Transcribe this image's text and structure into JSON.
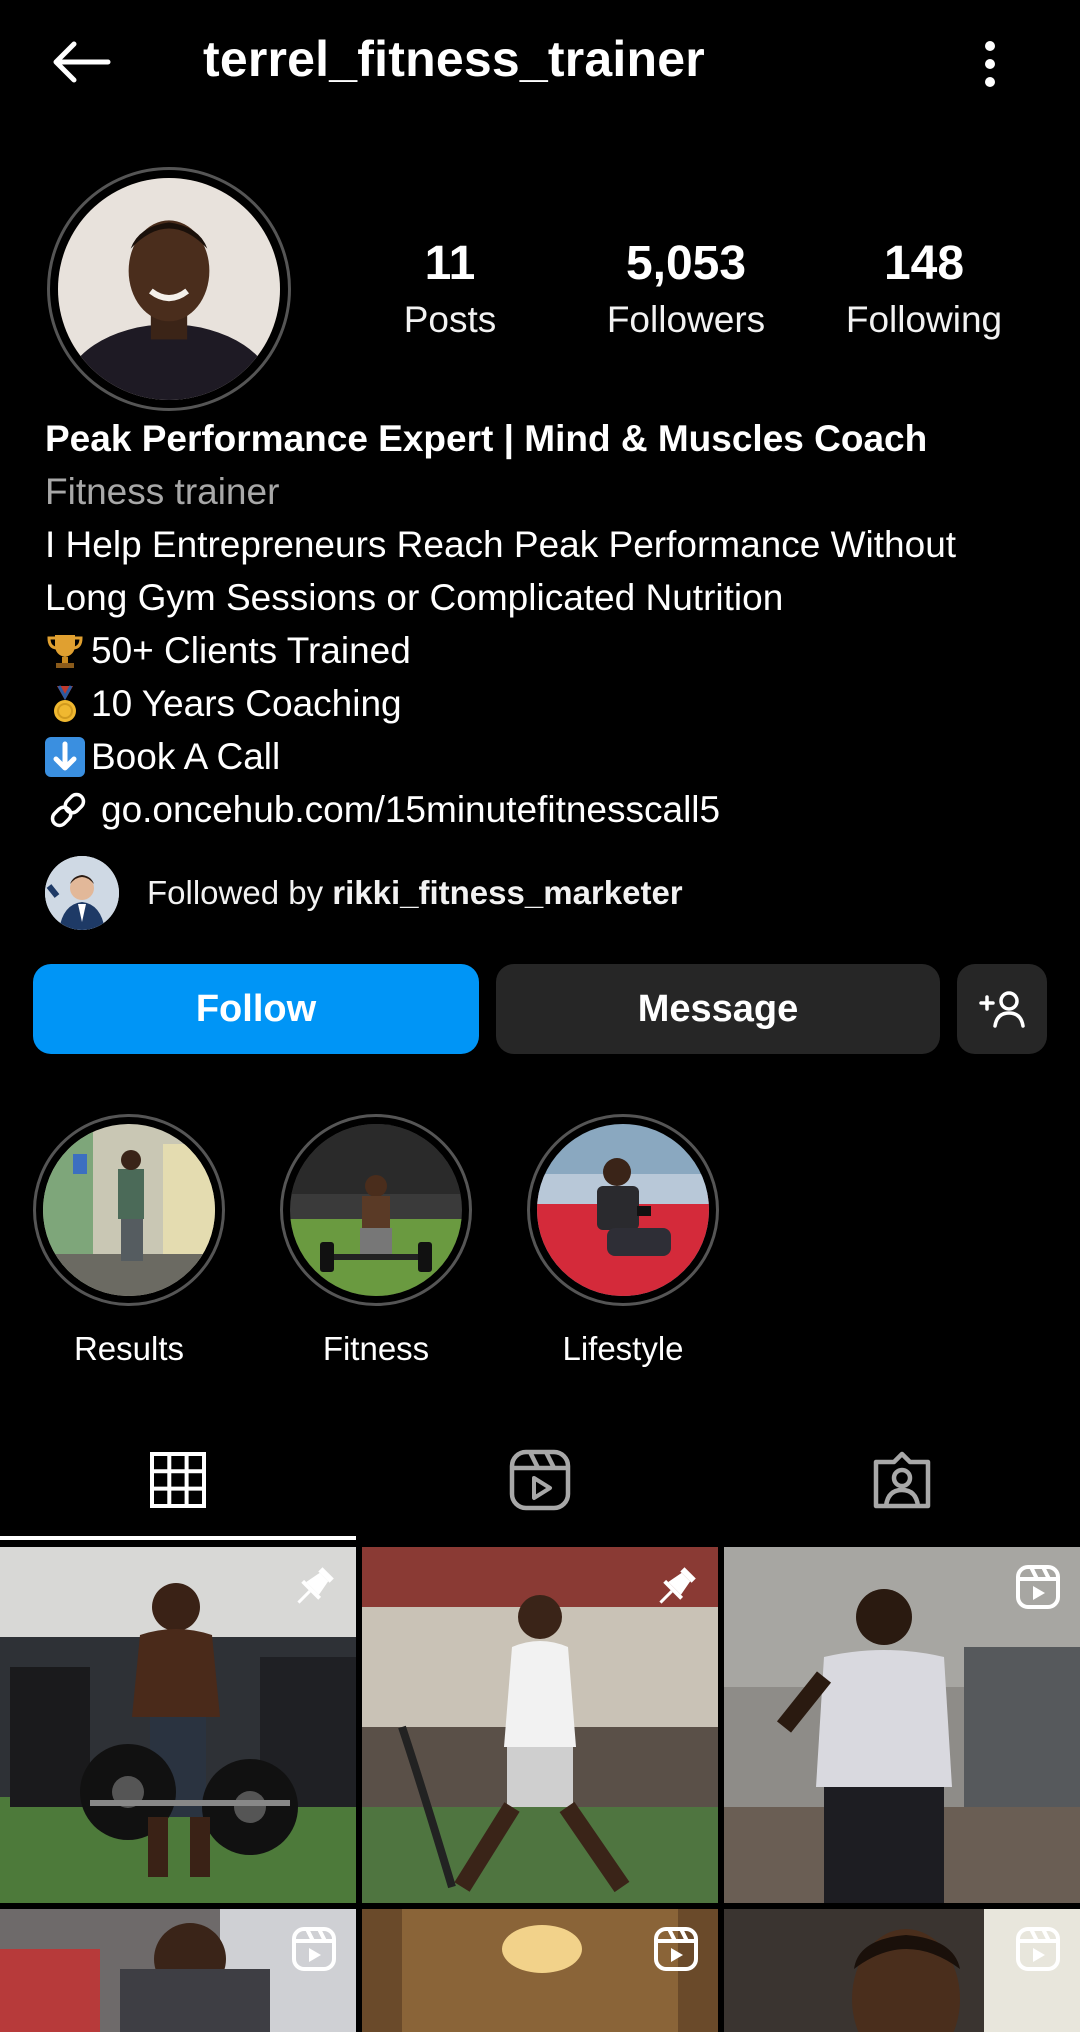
{
  "header": {
    "username": "terrel_fitness_trainer"
  },
  "stats": [
    {
      "value": "11",
      "label": "Posts"
    },
    {
      "value": "5,053",
      "label": "Followers"
    },
    {
      "value": "148",
      "label": "Following"
    }
  ],
  "bio": {
    "name": "Peak Performance Expert | Mind & Muscles Coach",
    "category": "Fitness trainer",
    "line1": "I Help Entrepreneurs Reach Peak Performance Without",
    "line2": "Long Gym Sessions or Complicated Nutrition",
    "bullet1": "50+ Clients Trained",
    "bullet2": "10 Years Coaching",
    "bullet3": "Book A Call",
    "link": "go.oncehub.com/15minutefitnesscall5"
  },
  "followed_by": {
    "prefix": "Followed by ",
    "user": "rikki_fitness_marketer"
  },
  "actions": {
    "follow": "Follow",
    "message": "Message"
  },
  "highlights": [
    {
      "label": "Results"
    },
    {
      "label": "Fitness"
    },
    {
      "label": "Lifestyle"
    }
  ],
  "tabs": [
    "posts-grid-icon",
    "reels-icon",
    "tagged-icon"
  ],
  "colors": {
    "accent": "#0095f6",
    "secondary_button": "#262626",
    "muted_text": "#a8a8a8"
  }
}
